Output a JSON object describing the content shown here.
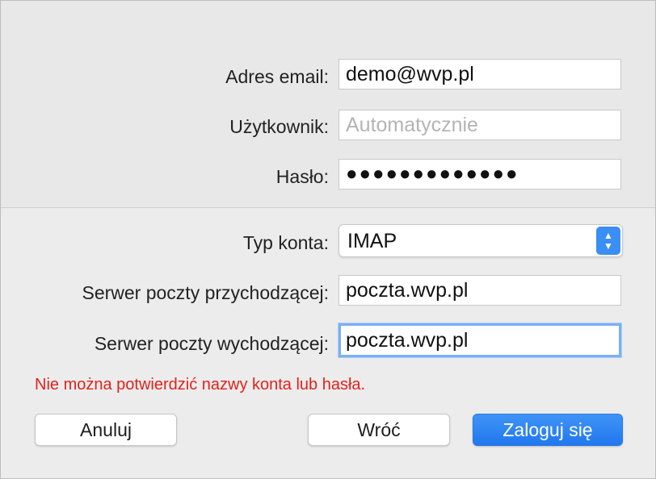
{
  "account_form": {
    "email": {
      "label": "Adres email:",
      "value": "demo@wvp.pl"
    },
    "username": {
      "label": "Użytkownik:",
      "value": "",
      "placeholder": "Automatycznie"
    },
    "password": {
      "label": "Hasło:",
      "value": "●●●●●●●●●●●●●"
    },
    "account_type": {
      "label": "Typ konta:",
      "value": "IMAP"
    },
    "incoming_server": {
      "label": "Serwer poczty przychodzącej:",
      "value": "poczta.wvp.pl"
    },
    "outgoing_server": {
      "label": "Serwer poczty wychodzącej:",
      "value": "poczta.wvp.pl"
    }
  },
  "error_message": "Nie można potwierdzić nazwy konta lub hasła.",
  "buttons": {
    "cancel": "Anuluj",
    "back": "Wróć",
    "sign_in": "Zaloguj się"
  },
  "colors": {
    "accent": "#2178ee",
    "error": "#e3211b"
  },
  "icons": {
    "stepper_up": "▲",
    "stepper_down": "▼"
  }
}
